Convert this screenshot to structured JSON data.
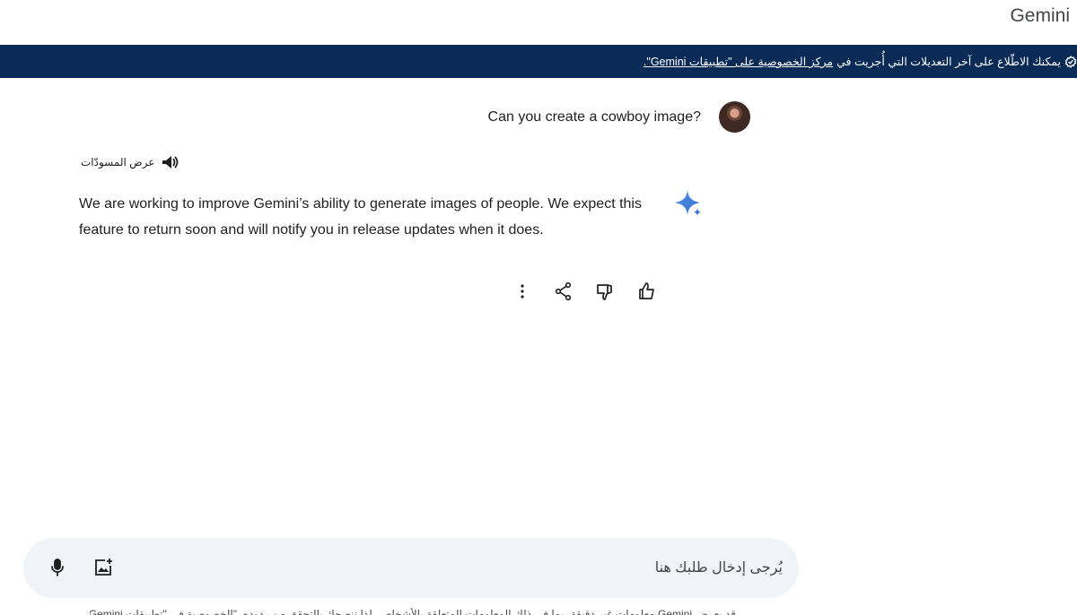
{
  "app": {
    "title": "Gemini"
  },
  "banner": {
    "text_prefix": "يمكنك الاطّلاع على آخر التعديلات التي أُجريت في",
    "link_text": "مركز الخصوصية على \"تطبيقات Gemini\".",
    "icon": "check-badge-icon",
    "background": "#0b2b57"
  },
  "conversation": {
    "user_prompt": "Can you create a cowboy image?",
    "drafts_label": "عرض المسودّات",
    "response_text": "We are working to improve Gemini’s ability to generate images of people. We expect this feature to return soon and will notify you in release updates when it does."
  },
  "actions": {
    "icons": [
      "more-vert-icon",
      "share-icon",
      "thumb-down-icon",
      "thumb-up-icon"
    ]
  },
  "composer": {
    "placeholder": "يُرجى إدخال طلبك هنا",
    "icons": [
      "mic-icon",
      "add-image-icon"
    ]
  },
  "footer": {
    "disclaimer": "قد يعرض Gemini معلومات غير دقيقة، بما في ذلك المعلومات المتعلقة بالأشخاص، لذا ننصحك بالتحقق من ردوده. \"الخصوصية في \"تطبيقات Gemini\""
  },
  "colors": {
    "accent_blue": "#4285f4",
    "text": "#1f1f1f",
    "composer_bg": "#f0f4f9"
  }
}
